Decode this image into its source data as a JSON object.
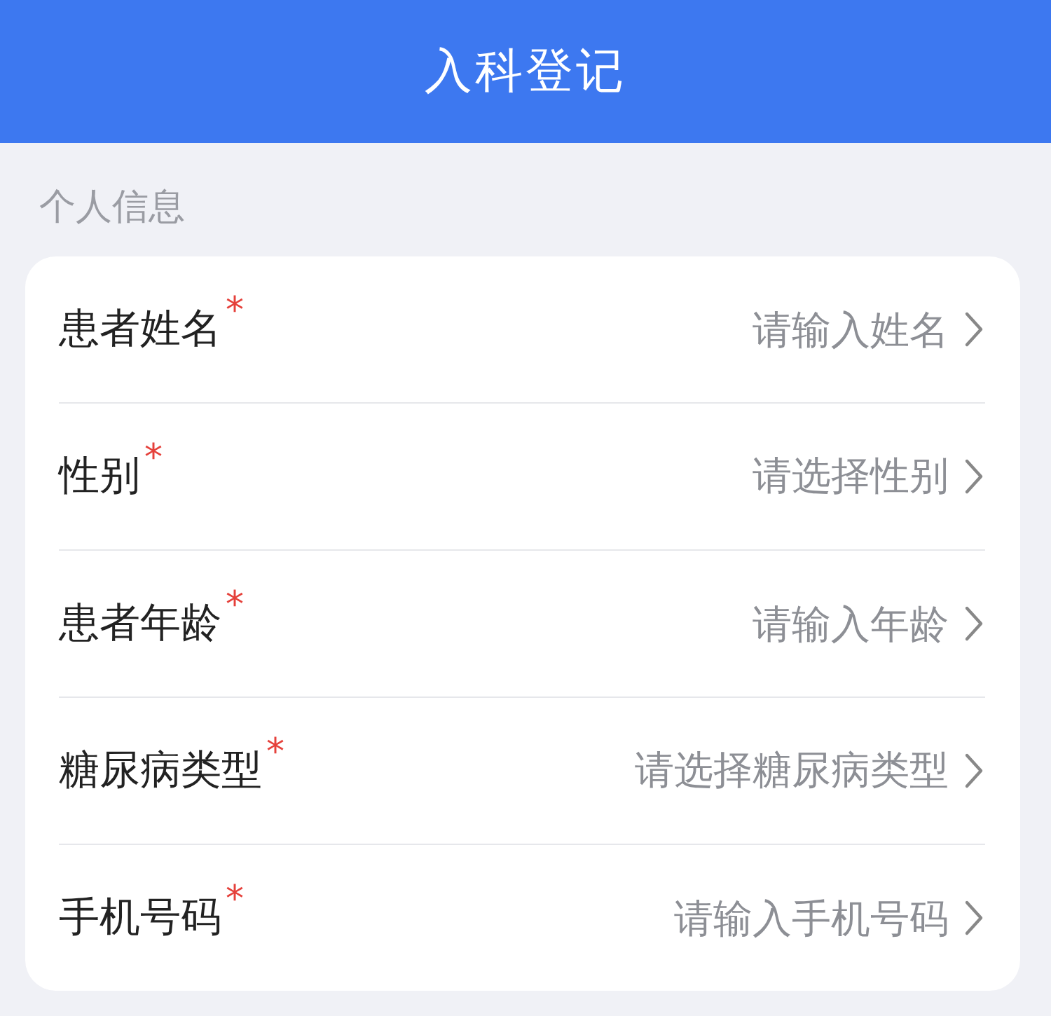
{
  "header": {
    "title": "入科登记"
  },
  "section": {
    "title": "个人信息"
  },
  "fields": [
    {
      "label": "患者姓名",
      "required_mark": "*",
      "kind": "input",
      "placeholder": "请输入姓名"
    },
    {
      "label": "性别",
      "required_mark": "*",
      "kind": "select",
      "placeholder": "请选择性别"
    },
    {
      "label": "患者年龄",
      "required_mark": "*",
      "kind": "input",
      "placeholder": "请输入年龄"
    },
    {
      "label": "糖尿病类型",
      "required_mark": "*",
      "kind": "select",
      "placeholder": "请选择糖尿病类型"
    },
    {
      "label": "手机号码",
      "required_mark": "*",
      "kind": "input",
      "placeholder": "请输入手机号码"
    }
  ]
}
